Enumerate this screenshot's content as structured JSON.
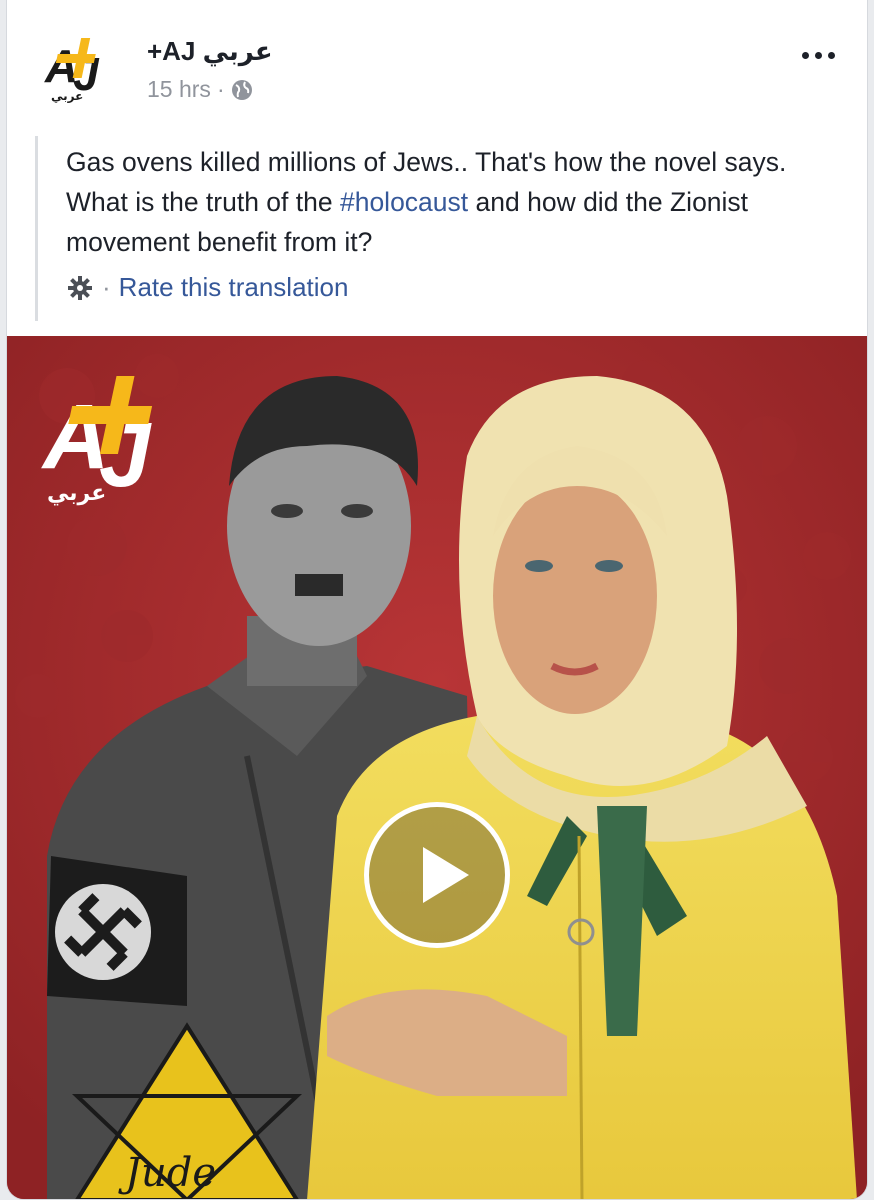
{
  "post": {
    "page_name": "+AJ عربي",
    "time": "15 hrs",
    "separator": "·",
    "text_before": "Gas ovens killed millions of Jews.. That's how the novel says. What is the truth of the ",
    "hashtag": "#holocaust",
    "text_after": " and how did the Zionist movement benefit from it?",
    "translation_separator": "·",
    "rate_translation": "Rate this translation"
  },
  "brand": {
    "logo_letters": "AJ",
    "logo_arabic": "عربي",
    "yellow": "#f6b81a",
    "black": "#1a1a1a"
  },
  "media": {
    "type": "video",
    "background_color": "#a82c2e",
    "armband_label": "swastika armband",
    "star_text": "Jude",
    "play_icon": "play-icon"
  },
  "colors": {
    "text": "#1d2129",
    "meta": "#90949c",
    "link": "#365899"
  }
}
